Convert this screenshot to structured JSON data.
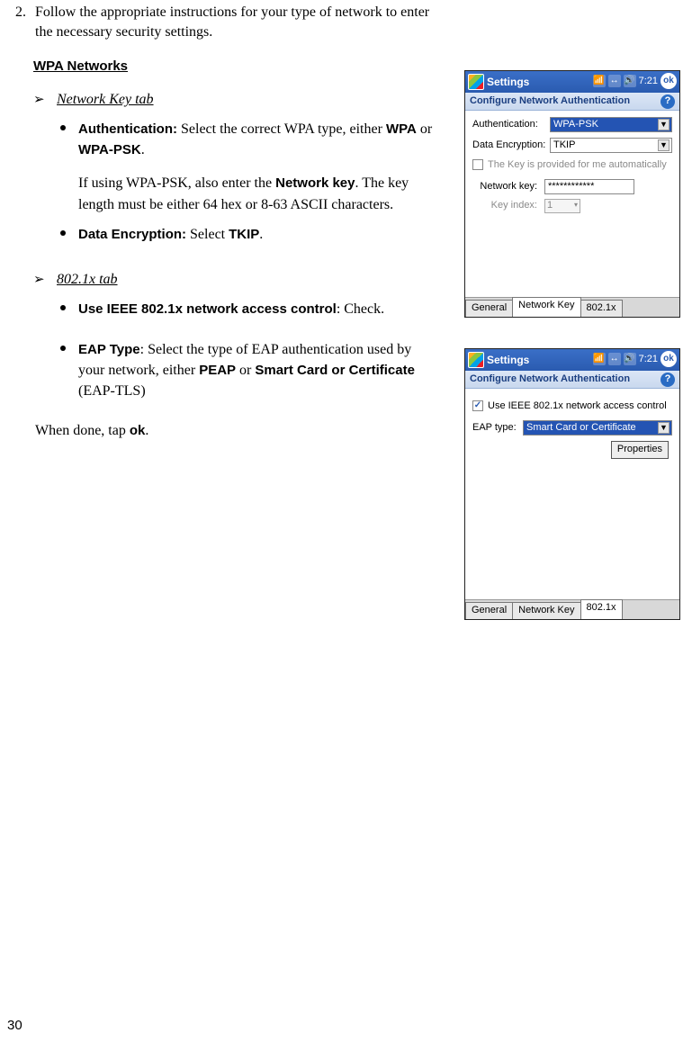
{
  "page_number": "30",
  "step2": {
    "num": "2.",
    "text": "Follow the appropriate instructions for your type of network to enter the necessary security settings."
  },
  "wpa_heading": "WPA Networks",
  "section_netkey": {
    "arrow": "➢",
    "title": "Network Key tab",
    "bullets": [
      {
        "label": "Authentication:",
        "tail1": " Select the correct WPA type, either ",
        "b1": "WPA",
        "mid1": " or ",
        "b2": "WPA-PSK",
        "end1": ".",
        "para2a": "If using WPA-PSK, also enter the ",
        "para2b": "Network key",
        "para2c": ". The key length must be either 64 hex or 8-63 ASCII characters."
      },
      {
        "label": "Data Encryption:",
        "tail1": " Select ",
        "b1": "TKIP",
        "end1": "."
      }
    ]
  },
  "section_8021x": {
    "arrow": "➢",
    "title": "802.1x tab",
    "bullets": [
      {
        "label": "Use IEEE 802.1x network access control",
        "tail1": ": Check."
      },
      {
        "label": "EAP Type",
        "tail1": ": Select the type of EAP authentication used by your network, either ",
        "b1": "PEAP",
        "mid1": " or ",
        "b2": "Smart Card or Certificate",
        "end1": " (EAP-TLS)"
      }
    ]
  },
  "done": {
    "a": "When done, tap ",
    "b": "ok",
    "c": "."
  },
  "screenshot1": {
    "settings": "Settings",
    "time": "7:21",
    "ok": "ok",
    "subtitle": "Configure Network Authentication",
    "help": "?",
    "auth_label": "Authentication:",
    "auth_value": "WPA-PSK",
    "enc_label": "Data Encryption:",
    "enc_value": "TKIP",
    "auto_key": "The Key is provided for me automatically",
    "netkey_label": "Network key:",
    "netkey_value": "************",
    "keyidx_label": "Key index:",
    "keyidx_value": "1",
    "tabs": {
      "general": "General",
      "netkey": "Network Key",
      "x": "802.1x"
    }
  },
  "screenshot2": {
    "settings": "Settings",
    "time": "7:21",
    "ok": "ok",
    "subtitle": "Configure Network Authentication",
    "help": "?",
    "use_ieee": "Use IEEE 802.1x network access control",
    "eap_label": "EAP type:",
    "eap_value": "Smart Card or Certificate",
    "properties": "Properties",
    "tabs": {
      "general": "General",
      "netkey": "Network Key",
      "x": "802.1x"
    }
  }
}
